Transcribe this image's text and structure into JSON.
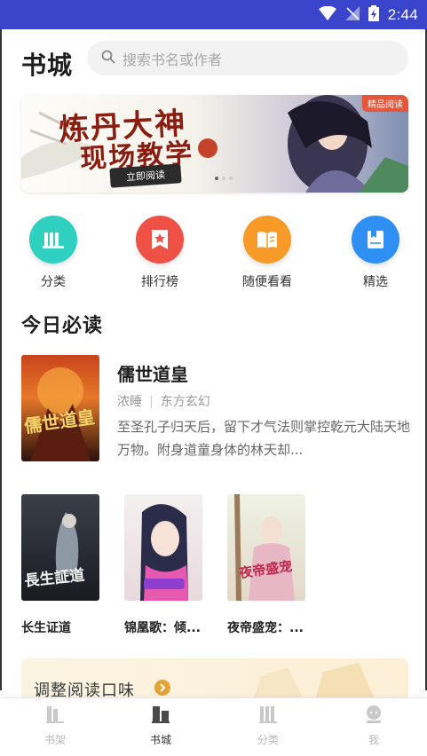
{
  "status_bar": {
    "time": "2:44"
  },
  "header": {
    "title": "书城",
    "search_placeholder": "搜索书名或作者"
  },
  "banner": {
    "line1": "炼丹大神",
    "line2": "现场教学",
    "button_label": "立即阅读",
    "tag": "精品阅读"
  },
  "quick_nav": [
    {
      "label": "分类",
      "color": "#2fd0c0",
      "icon": "library-icon"
    },
    {
      "label": "排行榜",
      "color": "#ef5146",
      "icon": "ranking-star-icon"
    },
    {
      "label": "随便看看",
      "color": "#f79a28",
      "icon": "open-book-icon"
    },
    {
      "label": "精选",
      "color": "#2f8ff2",
      "icon": "selected-book-icon"
    }
  ],
  "today_section": {
    "title": "今日必读"
  },
  "featured_book": {
    "name": "儒世道皇",
    "author": "浓睡",
    "genre": "东方玄幻",
    "description": "至圣孔子归天后，留下才气法则掌控乾元大陆天地万物。附身道童身体的林天却..."
  },
  "book_list": [
    {
      "name": "长生证道"
    },
    {
      "name": "锦凰歌：倾..."
    },
    {
      "name": "夜帝盛宠：..."
    }
  ],
  "promo": {
    "text": "调整阅读口味"
  },
  "tab_bar": [
    {
      "label": "书架",
      "icon": "bookshelf-icon",
      "active": false
    },
    {
      "label": "书城",
      "icon": "bookstore-icon",
      "active": true
    },
    {
      "label": "分类",
      "icon": "category-icon",
      "active": false
    },
    {
      "label": "我",
      "icon": "profile-icon",
      "active": false
    }
  ]
}
